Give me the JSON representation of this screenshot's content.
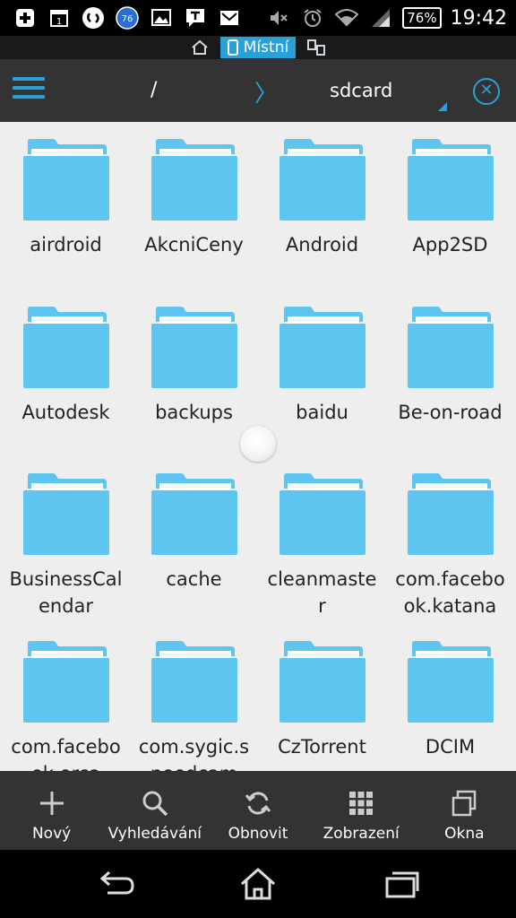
{
  "status_bar": {
    "left_icons": [
      "add-icon",
      "calendar-icon",
      "shazam-icon",
      "badge-icon",
      "image-icon",
      "chat-icon",
      "mail-icon"
    ],
    "calendar_day": "1",
    "badge_number": "76",
    "battery": "76%",
    "time": "19:42"
  },
  "location": {
    "active_label": "Místní"
  },
  "path": {
    "root": "/",
    "separator": "〉",
    "current": "sdcard"
  },
  "folders": [
    {
      "name": "airdroid"
    },
    {
      "name": "AkcniCeny"
    },
    {
      "name": "Android"
    },
    {
      "name": "App2SD"
    },
    {
      "name": "Autodesk"
    },
    {
      "name": "backups"
    },
    {
      "name": "baidu"
    },
    {
      "name": "Be-on-road"
    },
    {
      "name": "BusinessCalendar"
    },
    {
      "name": "cache"
    },
    {
      "name": "cleanmaster"
    },
    {
      "name": "com.facebook.katana"
    },
    {
      "name": "com.facebook.orca"
    },
    {
      "name": "com.sygic.speedcam"
    },
    {
      "name": "CzTorrent"
    },
    {
      "name": "DCIM"
    }
  ],
  "toolbar": {
    "new_label": "Nový",
    "search_label": "Vyhledávání",
    "refresh_label": "Obnovit",
    "view_label": "Zobrazení",
    "windows_label": "Okna"
  },
  "colors": {
    "accent": "#2aa0d8",
    "folder": "#5ec5f1",
    "folder_tab": "#5ec5f1",
    "background": "#eeeeee",
    "bar": "#333333"
  }
}
